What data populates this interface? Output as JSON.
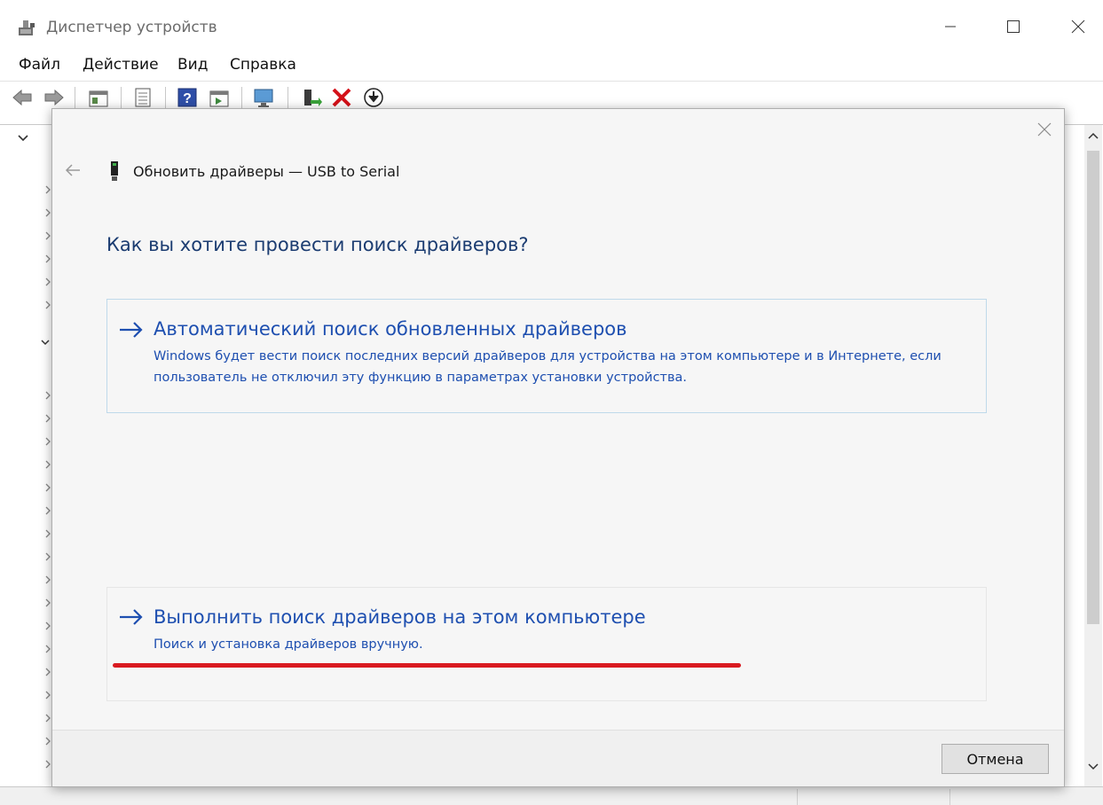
{
  "window": {
    "title": "Диспетчер устройств"
  },
  "menu": {
    "file": "Файл",
    "action": "Действие",
    "view": "Вид",
    "help": "Справка"
  },
  "toolbar": {
    "icons": [
      "back-arrow-icon",
      "forward-arrow-icon",
      "properties-icon",
      "list-icon",
      "help-icon",
      "view-icon",
      "monitor-icon",
      "add-driver-icon",
      "uninstall-icon",
      "download-icon"
    ]
  },
  "dialog": {
    "title": "Обновить драйверы — USB to Serial",
    "question": "Как вы хотите провести поиск драйверов?",
    "options": [
      {
        "title": "Автоматический поиск обновленных драйверов",
        "description": "Windows будет вести поиск последних версий драйверов для устройства на этом компьютере и в Интернете, если пользователь не отключил эту функцию в параметрах установки устройства."
      },
      {
        "title": "Выполнить поиск драйверов на этом компьютере",
        "description": "Поиск и установка драйверов вручную."
      }
    ],
    "cancel_label": "Отмена"
  },
  "colors": {
    "link_blue": "#1e4fb0",
    "heading_blue": "#1b3c71",
    "highlight_red": "#d91a20",
    "option_border": "#bfd9ea"
  }
}
